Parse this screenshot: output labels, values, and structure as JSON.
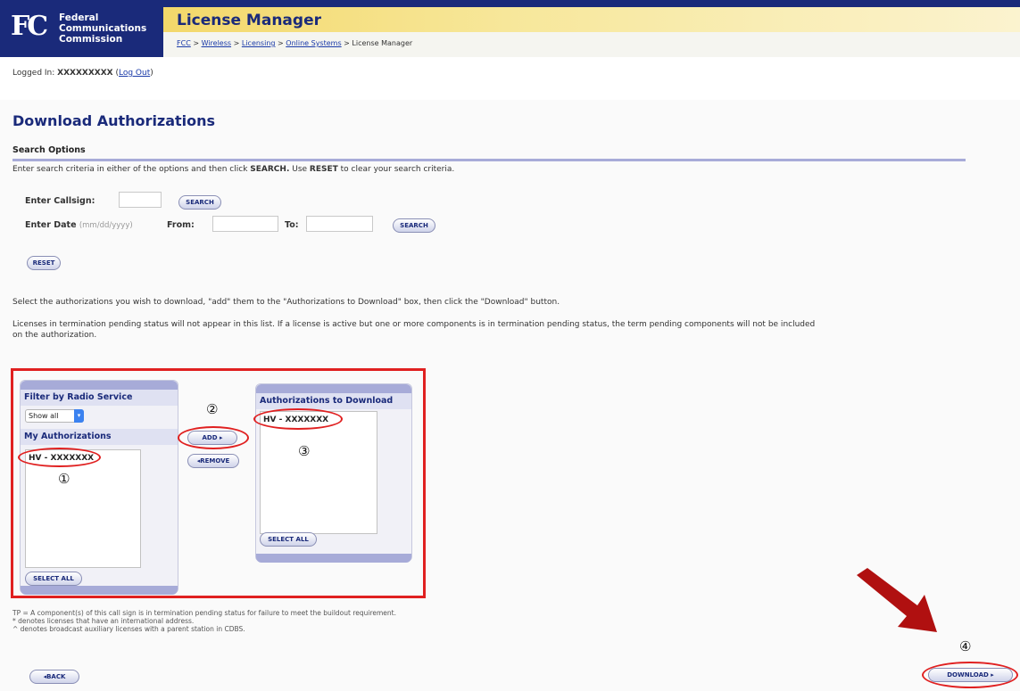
{
  "header": {
    "org_line1": "Federal",
    "org_line2": "Communications",
    "org_line3": "Commission",
    "logo_text": "FC",
    "app_title": "License Manager",
    "breadcrumbs": [
      "FCC",
      "Wireless",
      "Licensing",
      "Online Systems"
    ],
    "breadcrumb_sep": " > ",
    "breadcrumb_current": "License Manager"
  },
  "session": {
    "logged_in_label": "Logged In:",
    "username": "XXXXXXXXX",
    "logout_label": "Log Out"
  },
  "page": {
    "title": "Download Authorizations",
    "search_section_title": "Search Options",
    "search_instructions_1": "Enter search criteria in either of the options and then click ",
    "search_instructions_bold1": "SEARCH.",
    "search_instructions_2": " Use ",
    "search_instructions_bold2": "RESET",
    "search_instructions_3": " to clear your search criteria."
  },
  "search": {
    "callsign_label": "Enter Callsign:",
    "callsign_value": "",
    "date_label": "Enter Date",
    "date_hint": "(mm/dd/yyyy)",
    "from_label": "From:",
    "from_value": "",
    "to_label": "To:",
    "to_value": "",
    "search_button": "SEARCH",
    "reset_button": "RESET"
  },
  "instructions": {
    "select_text": "Select the authorizations you wish to download, \"add\" them to the \"Authorizations to Download\" box, then click the \"Download\" button.",
    "termination_text_1": "Licenses in termination pending status will not appear in this list. If a license is active but one or more components is in termination pending status, the term pending components will not be included",
    "termination_text_2": "on the authorization."
  },
  "left_panel": {
    "filter_title": "Filter by Radio Service",
    "filter_selected": "Show all",
    "my_auth_title": "My Authorizations",
    "items": [
      "HV - XXXXXXX"
    ],
    "select_all_button": "SELECT ALL"
  },
  "middle": {
    "add_button": "ADD",
    "remove_button": "REMOVE"
  },
  "right_panel": {
    "title": "Authorizations to Download",
    "items": [
      "HV - XXXXXXX"
    ],
    "select_all_button": "SELECT ALL"
  },
  "annotations": {
    "step1": "①",
    "step2": "②",
    "step3": "③",
    "step4": "④"
  },
  "footnotes": {
    "line1": "TP = A component(s) of this call sign is in termination pending status for failure to meet the buildout requirement.",
    "line2": "* denotes licenses that have an international address.",
    "line3": "^ denotes broadcast auxiliary licenses with a parent station in CDBS."
  },
  "footer": {
    "back_button": "BACK",
    "download_button": "DOWNLOAD"
  },
  "colors": {
    "brand_navy": "#1a2a7a",
    "accent_red": "#e02020",
    "band_yellow": "#f3d86a",
    "arrow_red": "#b01010"
  }
}
